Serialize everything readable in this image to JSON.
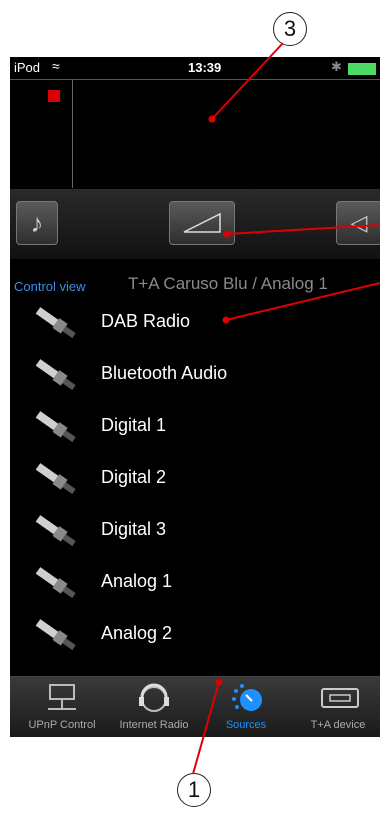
{
  "callouts": [
    "3",
    "1"
  ],
  "status_bar": {
    "carrier": "iPod",
    "time": "13:39"
  },
  "control_view_label": "Control view",
  "device_title": "T+A Caruso Blu / Analog 1",
  "sources": [
    "DAB Radio",
    "Bluetooth Audio",
    "Digital 1",
    "Digital 2",
    "Digital 3",
    "Analog 1",
    "Analog 2"
  ],
  "tabs": [
    {
      "label": "UPnP Control",
      "icon": "network-icon"
    },
    {
      "label": "Internet Radio",
      "icon": "globe-headphones-icon"
    },
    {
      "label": "Sources",
      "icon": "source-dial-icon",
      "active": true
    },
    {
      "label": "T+A device",
      "icon": "device-icon"
    }
  ],
  "colors": {
    "accent": "#1e90ff",
    "callout_line": "#e00000",
    "stop_indicator": "#dd0000"
  }
}
